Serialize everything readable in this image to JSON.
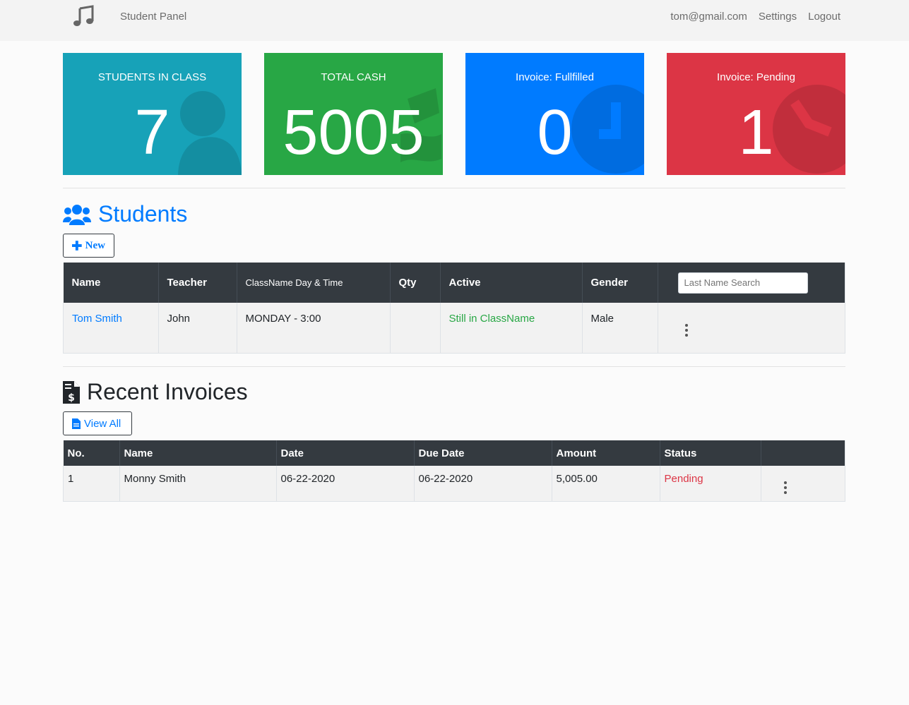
{
  "nav": {
    "brand": "Student Panel",
    "email": "tom@gmail.com",
    "settings": "Settings",
    "logout": "Logout"
  },
  "cards": [
    {
      "title": "STUDENTS IN CLASS",
      "value": "7",
      "color": "#17a2b8",
      "icon": "users-icon"
    },
    {
      "title": "TOTAL CASH",
      "value": "5005",
      "color": "#28a745",
      "icon": "money-icon"
    },
    {
      "title": "Invoice: Fullfilled",
      "value": "0",
      "color": "#007bff",
      "icon": "clock-icon"
    },
    {
      "title": "Invoice: Pending",
      "value": "1",
      "color": "#dc3545",
      "icon": "clock-icon"
    }
  ],
  "students": {
    "title": "Students",
    "new_button": "New",
    "search_placeholder": "Last Name Search",
    "headers": [
      "Name",
      "Teacher",
      "ClassName Day & Time",
      "Qty",
      "Active",
      "Gender"
    ],
    "rows": [
      {
        "name": "Tom Smith",
        "teacher": "John",
        "day_time": "MONDAY - 3:00",
        "qty": "",
        "active": "Still in ClassName",
        "gender": "Male"
      }
    ]
  },
  "invoices": {
    "title": "Recent Invoices",
    "view_all": "View All",
    "headers": [
      "No.",
      "Name",
      "Date",
      "Due Date",
      "Amount",
      "Status"
    ],
    "rows": [
      {
        "no": "1",
        "name": "Monny Smith",
        "date": "06-22-2020",
        "due_date": "06-22-2020",
        "amount": "5,005.00",
        "status": "Pending"
      }
    ]
  }
}
